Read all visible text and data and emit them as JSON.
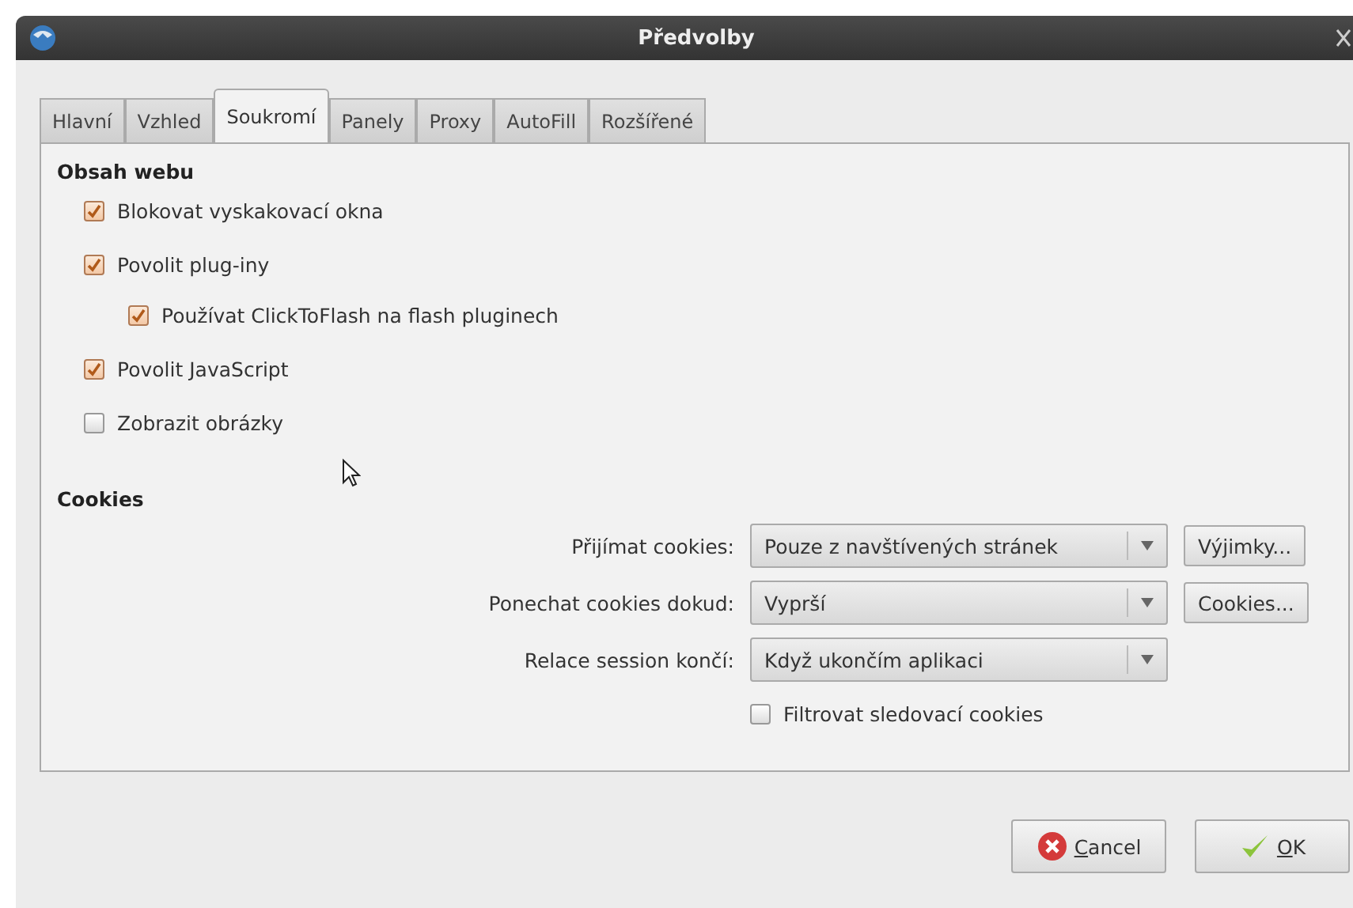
{
  "window": {
    "title": "Předvolby"
  },
  "tabs": [
    {
      "label": "Hlavní",
      "selected": false
    },
    {
      "label": "Vzhled",
      "selected": false
    },
    {
      "label": "Soukromí",
      "selected": true
    },
    {
      "label": "Panely",
      "selected": false
    },
    {
      "label": "Proxy",
      "selected": false
    },
    {
      "label": "AutoFill",
      "selected": false
    },
    {
      "label": "Rozšířené",
      "selected": false
    }
  ],
  "web_content": {
    "heading": "Obsah webu",
    "options": [
      {
        "label": "Blokovat vyskakovací okna",
        "checked": true
      },
      {
        "label": "Povolit plug-iny",
        "checked": true,
        "children": [
          {
            "label": "Používat ClickToFlash na flash pluginech",
            "checked": true
          }
        ]
      },
      {
        "label": "Povolit JavaScript",
        "checked": true
      },
      {
        "label": "Zobrazit obrázky",
        "checked": false
      }
    ]
  },
  "cookies": {
    "heading": "Cookies",
    "rows": [
      {
        "label": "Přijímat cookies:",
        "value": "Pouze z navštívených stránek",
        "button": "Výjimky..."
      },
      {
        "label": "Ponechat cookies dokud:",
        "value": "Vyprší",
        "button": "Cookies..."
      },
      {
        "label": "Relace session končí:",
        "value": "Když ukončím aplikaci"
      }
    ],
    "filter": {
      "label": "Filtrovat sledovací cookies",
      "checked": false
    }
  },
  "buttons": [
    {
      "label": "Cancel",
      "kind": "cancel"
    },
    {
      "label": "OK",
      "kind": "ok"
    }
  ]
}
